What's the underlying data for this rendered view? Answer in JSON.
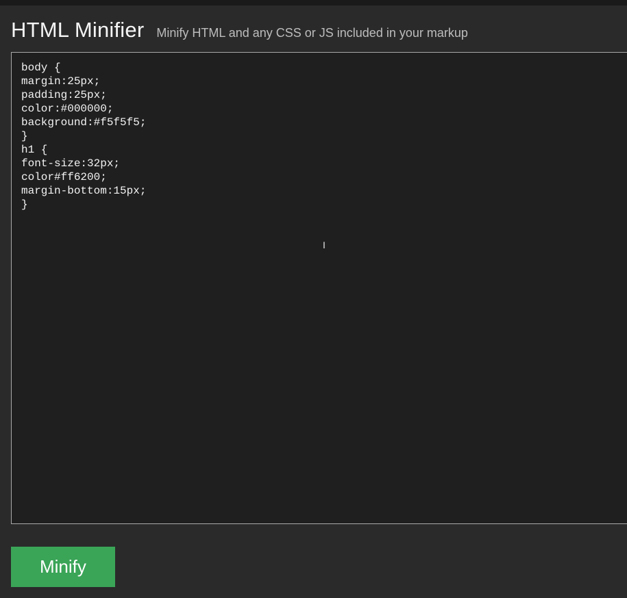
{
  "header": {
    "title": "HTML Minifier",
    "subtitle": "Minify HTML and any CSS or JS included in your markup"
  },
  "editor": {
    "content": "body {\nmargin:25px;\npadding:25px;\ncolor:#000000;\nbackground:#f5f5f5;\n}\nh1 {\nfont-size:32px;\ncolor#ff6200;\nmargin-bottom:15px;\n}"
  },
  "actions": {
    "minify_label": "Minify"
  }
}
